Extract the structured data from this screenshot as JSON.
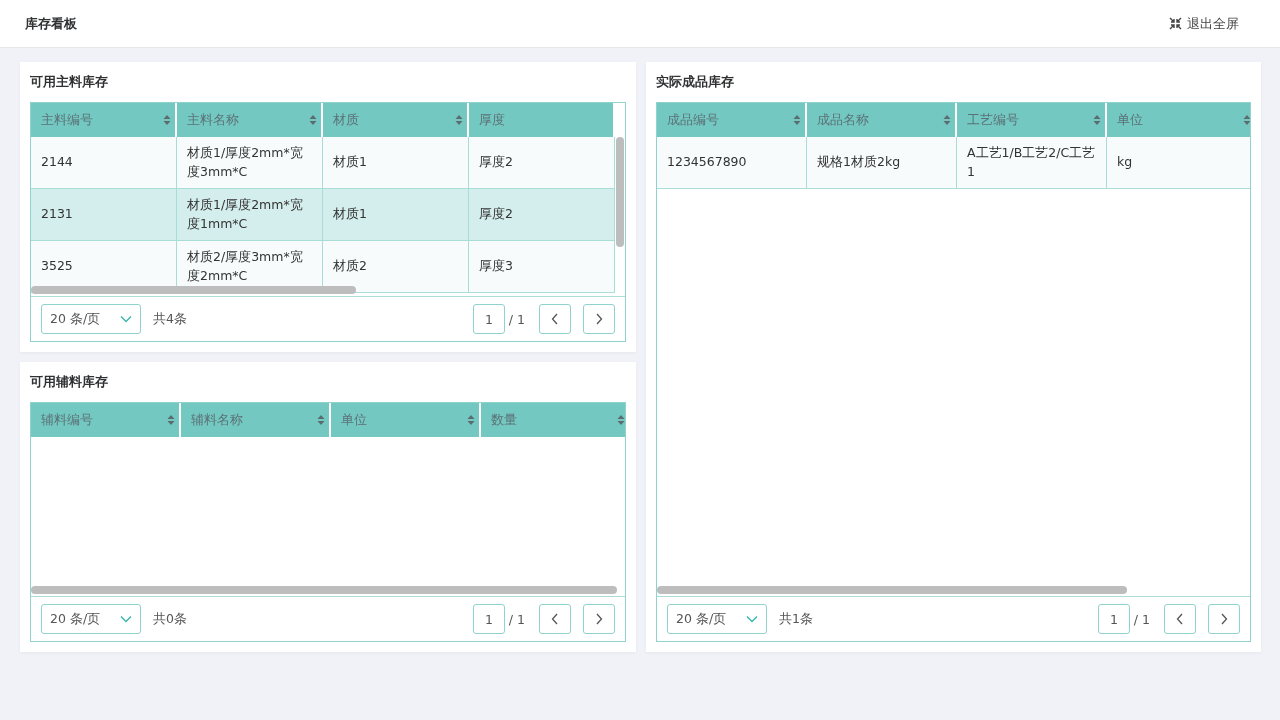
{
  "header": {
    "title": "库存看板",
    "exit_button": "退出全屏"
  },
  "panels": [
    {
      "title": "可用主料库存",
      "columns": [
        {
          "label": "主料编号",
          "sortable": true
        },
        {
          "label": "主料名称",
          "sortable": true
        },
        {
          "label": "材质",
          "sortable": true
        },
        {
          "label": "厚度",
          "sortable": false
        }
      ],
      "rows": [
        {
          "cells": [
            "2144",
            "材质1/厚度2mm*宽度3mm*C",
            "材质1",
            "厚度2"
          ],
          "selected": false
        },
        {
          "cells": [
            "2131",
            "材质1/厚度2mm*宽度1mm*C",
            "材质1",
            "厚度2"
          ],
          "selected": true
        },
        {
          "cells": [
            "3525",
            "材质2/厚度3mm*宽度2mm*C",
            "材质2",
            "厚度3"
          ],
          "selected": false
        }
      ],
      "pagination": {
        "page_size": "20 条/页",
        "total": "共4条",
        "page": "1",
        "pages": "/ 1"
      }
    },
    {
      "title": "可用辅料库存",
      "columns": [
        {
          "label": "辅料编号",
          "sortable": true
        },
        {
          "label": "辅料名称",
          "sortable": true
        },
        {
          "label": "单位",
          "sortable": true
        },
        {
          "label": "数量",
          "sortable": true
        }
      ],
      "pagination": {
        "page_size": "20 条/页",
        "total": "共0条",
        "page": "1",
        "pages": "/ 1"
      }
    },
    {
      "title": "实际成品库存",
      "columns": [
        {
          "label": "成品编号",
          "sortable": true
        },
        {
          "label": "成品名称",
          "sortable": true
        },
        {
          "label": "工艺编号",
          "sortable": true
        },
        {
          "label": "单位",
          "sortable": true
        }
      ],
      "rows": [
        {
          "cells": [
            "1234567890",
            "规格1材质2kg",
            "A工艺1/B工艺2/C工艺1",
            "kg"
          ],
          "selected": false
        }
      ],
      "pagination": {
        "page_size": "20 条/页",
        "total": "共1条",
        "page": "1",
        "pages": "/ 1"
      }
    }
  ]
}
